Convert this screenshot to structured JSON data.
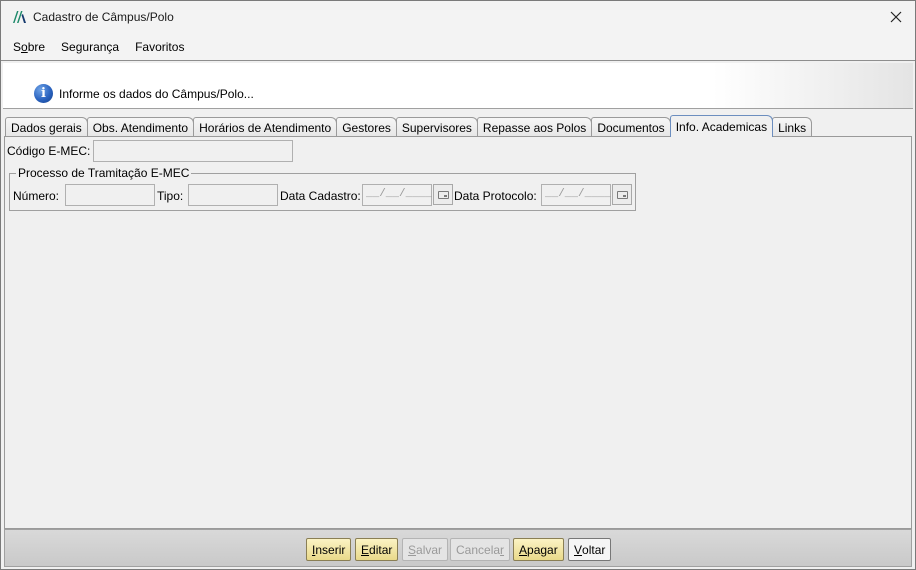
{
  "window": {
    "title": "Cadastro de Câmpus/Polo"
  },
  "menu": [
    {
      "pre": "S",
      "u": "o",
      "post": "bre"
    },
    {
      "pre": "",
      "u": "",
      "post": "Segurança"
    },
    {
      "pre": "",
      "u": "",
      "post": "Favoritos"
    }
  ],
  "banner": {
    "text": "Informe os dados do Câmpus/Polo..."
  },
  "tabs": [
    "Dados gerais",
    "Obs. Atendimento",
    "Horários de Atendimento",
    "Gestores",
    "Supervisores",
    "Repasse aos Polos",
    "Documentos",
    "Info. Academicas",
    "Links"
  ],
  "active_tab": "Info. Academicas",
  "form": {
    "codigo_label": "Código E-MEC:",
    "codigo_value": "",
    "group_title": "Processo de Tramitação E-MEC",
    "numero_label": "Número:",
    "numero_value": "",
    "tipo_label": "Tipo:",
    "tipo_value": "",
    "data_cadastro_label": "Data Cadastro:",
    "data_cadastro_value": "__/__/____",
    "data_protocolo_label": "Data Protocolo:",
    "data_protocolo_value": "__/__/____"
  },
  "buttons": {
    "inserir": {
      "pre": "",
      "u": "I",
      "post": "nserir",
      "state": "enabled"
    },
    "editar": {
      "pre": "",
      "u": "E",
      "post": "ditar",
      "state": "enabled"
    },
    "salvar": {
      "pre": "",
      "u": "S",
      "post": "alvar",
      "state": "disabled"
    },
    "cancelar": {
      "pre": "Cancela",
      "u": "r",
      "post": "",
      "state": "disabled"
    },
    "apagar": {
      "pre": "",
      "u": "A",
      "post": "pagar",
      "state": "enabled"
    },
    "voltar": {
      "pre": "",
      "u": "V",
      "post": "oltar",
      "state": "enabled"
    }
  },
  "colors": {
    "active_button": "#e9d98a",
    "info_icon": "#2a63c0",
    "app_icon": "#1f8a6b"
  },
  "icons": [
    "app-logo-icon",
    "close-icon",
    "info-icon",
    "calendar-icon"
  ]
}
